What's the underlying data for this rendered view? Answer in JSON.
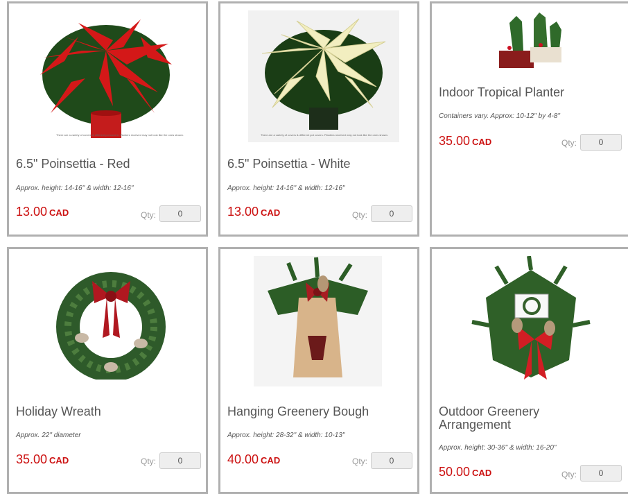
{
  "products": [
    {
      "title": "6.5\" Poinsettia - Red",
      "desc": "Approx. height: 14-16\" & width: 12-16\"",
      "price": "13.00",
      "currency": "CAD",
      "qty_label": "Qty:",
      "qty": "0",
      "image_icon": "red-poinsettia-icon",
      "image_note": "There are a variety of covers & different pot covers. Planters received may not look like the ones shown."
    },
    {
      "title": "6.5\" Poinsettia - White",
      "desc": "Approx. height: 14-16\" & width: 12-16\"",
      "price": "13.00",
      "currency": "CAD",
      "qty_label": "Qty:",
      "qty": "0",
      "image_icon": "white-poinsettia-icon",
      "image_note": "There are a variety of covers & different pot covers. Planters received may not look like the ones shown."
    },
    {
      "title": "Indoor Tropical Planter",
      "desc": "Containers vary. Approx: 10-12\" by 4-8\"",
      "price": "35.00",
      "currency": "CAD",
      "qty_label": "Qty:",
      "qty": "0",
      "image_icon": "tropical-planter-icon"
    },
    {
      "title": "Holiday Wreath",
      "desc": "Approx. 22\" diameter",
      "price": "35.00",
      "currency": "CAD",
      "qty_label": "Qty:",
      "qty": "0",
      "image_icon": "wreath-icon"
    },
    {
      "title": "Hanging Greenery Bough",
      "desc": "Approx. height: 28-32\" & width: 10-13\"",
      "price": "40.00",
      "currency": "CAD",
      "qty_label": "Qty:",
      "qty": "0",
      "image_icon": "greenery-bough-icon"
    },
    {
      "title": "Outdoor Greenery Arrangement",
      "desc": "Approx. height: 30-36\" & width: 16-20\"",
      "price": "50.00",
      "currency": "CAD",
      "qty_label": "Qty:",
      "qty": "0",
      "image_icon": "greenery-arrangement-icon"
    }
  ],
  "colors": {
    "price": "#cc1111",
    "border": "#b0b0b0",
    "title": "#555555"
  }
}
